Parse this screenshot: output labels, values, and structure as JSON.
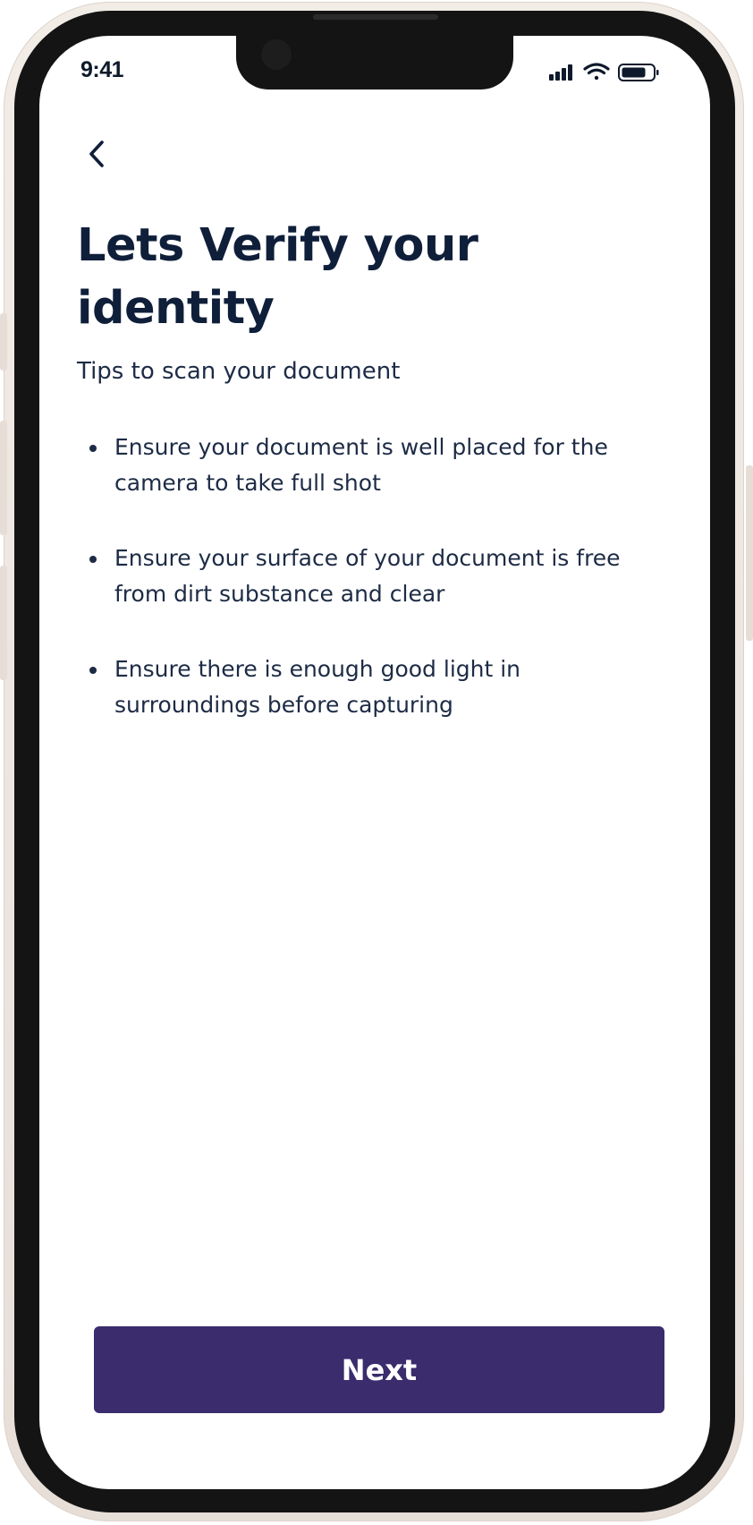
{
  "status_bar": {
    "time": "9:41",
    "icons": [
      "cellular-signal-icon",
      "wifi-icon",
      "battery-icon"
    ]
  },
  "header": {
    "back_icon": "chevron-left-icon",
    "title": "Lets Verify your identity",
    "subtitle": "Tips to scan your document"
  },
  "tips": [
    "Ensure your document is well placed for the camera to take full shot",
    "Ensure your surface of your document is free from dirt substance and clear",
    "Ensure there is enough good light in surroundings before capturing"
  ],
  "footer": {
    "next_label": "Next"
  },
  "colors": {
    "primary_button": "#3a2c6d",
    "heading_text": "#0f1f3a",
    "body_text": "#1d2b45",
    "screen_background": "#ffffff"
  }
}
